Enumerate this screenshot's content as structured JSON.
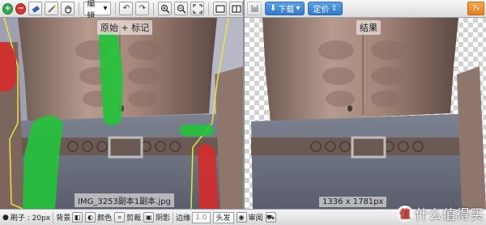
{
  "left_toolbar": {
    "add_label": "+",
    "remove_label": "−",
    "edit_select": "编辑",
    "icons": [
      "plus-icon",
      "minus-icon",
      "eraser-icon",
      "wand-icon",
      "hand-icon",
      "undo-icon",
      "redo-icon",
      "zoom-in-icon",
      "zoom-out-icon",
      "fit-icon",
      "single-view-icon",
      "split-view-icon"
    ]
  },
  "right_toolbar": {
    "download_label": "下载",
    "custom_label": "定价",
    "help_label": "?"
  },
  "left_pane": {
    "label": "原始 + 标记",
    "filename": "IMG_3253副本1副本.jpg"
  },
  "right_pane": {
    "label": "结果",
    "dimensions": "1336 x 1781px"
  },
  "bottom_toolbar": {
    "brush_label": "刷子 : 20px",
    "background_label": "背景",
    "color_label": "颜色",
    "crop_label": "剪裁",
    "shadow_label": "阴影",
    "edge_label": "边缘",
    "edge_value": "1.0",
    "hair_label": "头发",
    "review_label": "审阅"
  },
  "watermark": {
    "badge": "值",
    "text": "什么值得买"
  },
  "colors": {
    "accent_blue": "#2f7ac9",
    "mark_green": "#22c43a",
    "mark_red": "#d62b2b",
    "outline_yellow": "#e8e53a"
  }
}
